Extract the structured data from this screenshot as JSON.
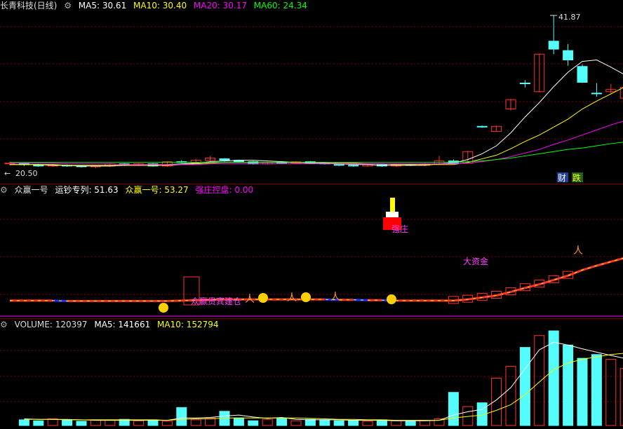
{
  "header_main": {
    "title": "长青科技(日线)",
    "ma5": "MA5: 30.61",
    "ma10": "MA10: 30.40",
    "ma20": "MA20: 30.17",
    "ma60": "MA60: 24.34"
  },
  "header_ind": {
    "name": "众赢一号",
    "l1": "运钞专列: 51.63",
    "l2": "众赢一号: 53.27",
    "l3": "强庄控盘: 0.00"
  },
  "header_vol": {
    "vol": "VOLUME: 120397",
    "ma5": "MA5: 141661",
    "ma10": "MA10: 152794"
  },
  "annotations": {
    "high": "41.87",
    "low": "20.50",
    "cai": "财",
    "die": "跌",
    "qiangzhuang": "强庄",
    "jiancang": "众赢贵宾建仓",
    "dazijin": "大资金"
  },
  "colors": {
    "up": "#ff3232",
    "down": "#54fcfc",
    "ma5": "#ffffff",
    "ma10": "#ffff00",
    "ma20": "#ff00ff",
    "ma60": "#00ff00",
    "grid": "#800000"
  },
  "chart_data": {
    "type": "candlestick",
    "price_range": [
      20.5,
      41.87
    ],
    "candles": [
      {
        "o": 21.3,
        "c": 21.4,
        "h": 21.6,
        "l": 21.1
      },
      {
        "o": 21.4,
        "c": 21.2,
        "h": 21.5,
        "l": 21.0
      },
      {
        "o": 21.2,
        "c": 21.0,
        "h": 21.3,
        "l": 20.9
      },
      {
        "o": 21.0,
        "c": 21.1,
        "h": 21.3,
        "l": 20.9
      },
      {
        "o": 21.1,
        "c": 21.0,
        "h": 21.2,
        "l": 20.9
      },
      {
        "o": 21.0,
        "c": 20.9,
        "h": 21.1,
        "l": 20.8
      },
      {
        "o": 20.9,
        "c": 21.0,
        "h": 21.1,
        "l": 20.7
      },
      {
        "o": 21.0,
        "c": 21.3,
        "h": 21.4,
        "l": 20.9
      },
      {
        "o": 21.3,
        "c": 21.1,
        "h": 21.4,
        "l": 21.0
      },
      {
        "o": 21.1,
        "c": 21.3,
        "h": 21.4,
        "l": 21.0
      },
      {
        "o": 21.3,
        "c": 21.0,
        "h": 21.4,
        "l": 20.9
      },
      {
        "o": 21.0,
        "c": 21.6,
        "h": 21.7,
        "l": 20.9
      },
      {
        "o": 21.6,
        "c": 21.5,
        "h": 21.8,
        "l": 21.4
      },
      {
        "o": 21.5,
        "c": 21.8,
        "h": 22.0,
        "l": 21.4
      },
      {
        "o": 21.8,
        "c": 22.1,
        "h": 22.4,
        "l": 21.6
      },
      {
        "o": 22.0,
        "c": 21.8,
        "h": 22.1,
        "l": 21.6
      },
      {
        "o": 21.8,
        "c": 21.6,
        "h": 21.9,
        "l": 21.5
      },
      {
        "o": 21.6,
        "c": 21.3,
        "h": 21.7,
        "l": 21.2
      },
      {
        "o": 21.3,
        "c": 21.5,
        "h": 21.6,
        "l": 21.2
      },
      {
        "o": 21.5,
        "c": 21.4,
        "h": 21.6,
        "l": 21.3
      },
      {
        "o": 21.4,
        "c": 21.6,
        "h": 21.7,
        "l": 21.3
      },
      {
        "o": 21.6,
        "c": 21.4,
        "h": 21.7,
        "l": 21.3
      },
      {
        "o": 21.4,
        "c": 21.3,
        "h": 21.5,
        "l": 21.2
      },
      {
        "o": 21.3,
        "c": 21.1,
        "h": 21.4,
        "l": 21.0
      },
      {
        "o": 21.1,
        "c": 21.0,
        "h": 21.2,
        "l": 20.9
      },
      {
        "o": 21.0,
        "c": 21.2,
        "h": 21.3,
        "l": 20.9
      },
      {
        "o": 21.2,
        "c": 21.0,
        "h": 21.3,
        "l": 20.9
      },
      {
        "o": 21.0,
        "c": 21.2,
        "h": 21.3,
        "l": 20.9
      },
      {
        "o": 21.2,
        "c": 21.1,
        "h": 21.3,
        "l": 21.0
      },
      {
        "o": 21.1,
        "c": 21.3,
        "h": 21.4,
        "l": 21.0
      },
      {
        "o": 21.3,
        "c": 21.7,
        "h": 22.4,
        "l": 21.2
      },
      {
        "o": 21.7,
        "c": 21.4,
        "h": 21.9,
        "l": 21.3
      },
      {
        "o": 21.4,
        "c": 23.0,
        "h": 23.1,
        "l": 21.3
      },
      {
        "o": 26.5,
        "c": 26.4,
        "h": 26.6,
        "l": 26.3
      },
      {
        "o": 25.8,
        "c": 26.5,
        "h": 26.6,
        "l": 25.8
      },
      {
        "o": 28.9,
        "c": 30.2,
        "h": 30.3,
        "l": 28.7
      },
      {
        "o": 32.5,
        "c": 32.4,
        "h": 32.9,
        "l": 31.9
      },
      {
        "o": 31.3,
        "c": 36.5,
        "h": 36.6,
        "l": 31.2
      },
      {
        "o": 38.3,
        "c": 37.2,
        "h": 41.87,
        "l": 36.5
      },
      {
        "o": 37.0,
        "c": 35.7,
        "h": 37.9,
        "l": 34.9
      },
      {
        "o": 34.8,
        "c": 32.6,
        "h": 35.1,
        "l": 32.5
      },
      {
        "o": 31.1,
        "c": 31.0,
        "h": 32.5,
        "l": 30.6
      },
      {
        "o": 31.3,
        "c": 31.6,
        "h": 32.4,
        "l": 31.0
      },
      {
        "o": 30.4,
        "c": 31.9,
        "h": 32.0,
        "l": 30.3
      }
    ],
    "ma5": [
      21.2,
      21.2,
      21.2,
      21.1,
      21.1,
      21.0,
      21.0,
      21.0,
      21.1,
      21.1,
      21.1,
      21.2,
      21.3,
      21.4,
      21.6,
      21.7,
      21.8,
      21.8,
      21.7,
      21.6,
      21.5,
      21.4,
      21.4,
      21.3,
      21.2,
      21.2,
      21.1,
      21.1,
      21.1,
      21.1,
      21.3,
      21.4,
      21.9,
      22.7,
      23.8,
      25.6,
      27.8,
      29.8,
      32.0,
      34.0,
      35.5,
      35.7,
      34.7,
      33.6
    ],
    "ma10": [
      21.2,
      21.2,
      21.2,
      21.2,
      21.1,
      21.1,
      21.1,
      21.1,
      21.1,
      21.1,
      21.1,
      21.1,
      21.2,
      21.3,
      21.4,
      21.5,
      21.5,
      21.5,
      21.5,
      21.5,
      21.5,
      21.5,
      21.5,
      21.4,
      21.4,
      21.3,
      21.3,
      21.2,
      21.2,
      21.2,
      21.2,
      21.2,
      21.5,
      22.0,
      22.5,
      23.4,
      24.4,
      25.3,
      26.4,
      27.5,
      28.9,
      30.0,
      31.0,
      32.0
    ],
    "ma20": [
      21.4,
      21.4,
      21.4,
      21.4,
      21.3,
      21.3,
      21.3,
      21.3,
      21.2,
      21.2,
      21.2,
      21.2,
      21.2,
      21.2,
      21.3,
      21.3,
      21.3,
      21.3,
      21.3,
      21.3,
      21.3,
      21.3,
      21.3,
      21.3,
      21.3,
      21.3,
      21.3,
      21.3,
      21.3,
      21.3,
      21.3,
      21.3,
      21.4,
      21.6,
      21.9,
      22.3,
      22.8,
      23.3,
      24.0,
      24.6,
      25.3,
      26.0,
      26.7,
      27.3
    ],
    "ma60": [
      21.5,
      21.5,
      21.5,
      21.5,
      21.5,
      21.5,
      21.5,
      21.5,
      21.5,
      21.5,
      21.5,
      21.5,
      21.5,
      21.5,
      21.5,
      21.5,
      21.5,
      21.5,
      21.5,
      21.5,
      21.5,
      21.5,
      21.5,
      21.5,
      21.5,
      21.5,
      21.5,
      21.5,
      21.5,
      21.5,
      21.5,
      21.5,
      21.6,
      21.7,
      21.9,
      22.1,
      22.4,
      22.7,
      23.0,
      23.3,
      23.5,
      23.8,
      24.1,
      24.34
    ],
    "volume": {
      "values": [
        12000,
        10000,
        14000,
        11000,
        9000,
        12000,
        11000,
        13000,
        10000,
        12000,
        9000,
        38000,
        12000,
        16000,
        30000,
        16000,
        10000,
        13000,
        16000,
        10000,
        13000,
        12000,
        10000,
        11000,
        9000,
        12000,
        10000,
        10000,
        11000,
        14000,
        70000,
        40000,
        48000,
        100000,
        125000,
        165000,
        190000,
        200000,
        170000,
        142000,
        150000,
        140000,
        120397
      ],
      "ma5": [
        14000,
        13000,
        13000,
        12000,
        12000,
        11000,
        11000,
        11000,
        11000,
        11000,
        11000,
        16000,
        16000,
        17000,
        20000,
        22000,
        18000,
        15000,
        17000,
        13000,
        12000,
        12000,
        12000,
        11000,
        11000,
        11000,
        10000,
        10000,
        10000,
        11000,
        22000,
        29000,
        34000,
        54000,
        80000,
        120000,
        160000,
        176000,
        170000,
        162000,
        155000,
        148000,
        141661
      ],
      "ma10": [
        13000,
        13000,
        13000,
        13000,
        12000,
        12000,
        12000,
        12000,
        12000,
        12000,
        11000,
        13000,
        14000,
        14000,
        16000,
        16000,
        16000,
        16000,
        16000,
        16000,
        15000,
        14000,
        13000,
        13000,
        12000,
        12000,
        11000,
        11000,
        11000,
        11000,
        16000,
        19000,
        22000,
        32000,
        44000,
        65000,
        92000,
        118000,
        132000,
        140000,
        145000,
        150000,
        152794
      ]
    }
  }
}
